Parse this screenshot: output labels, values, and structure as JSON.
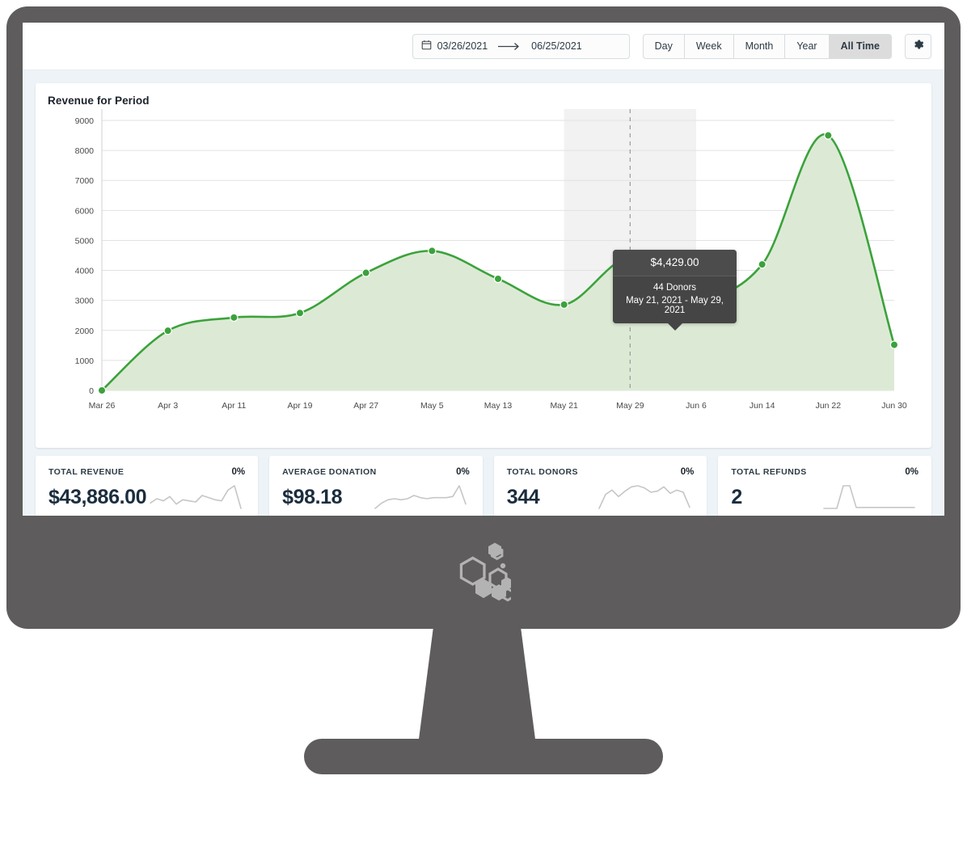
{
  "toolbar": {
    "calendar_icon": "calendar-icon",
    "date_start": "03/26/2021",
    "date_end": "06/25/2021",
    "arrow_icon": "arrow-right-icon",
    "gear_icon": "gear-icon",
    "ranges": [
      {
        "label": "Day",
        "active": false
      },
      {
        "label": "Week",
        "active": false
      },
      {
        "label": "Month",
        "active": false
      },
      {
        "label": "Year",
        "active": false
      },
      {
        "label": "All Time",
        "active": true
      }
    ]
  },
  "tooltip": {
    "amount": "$4,429.00",
    "donors": "44 Donors",
    "range": "May 21, 2021 - May 29, 2021"
  },
  "kpis": [
    {
      "label": "Total Revenue",
      "percent": "0%",
      "value": "$43,886.00",
      "spark": [
        14,
        18,
        16,
        20,
        13,
        17,
        16,
        15,
        21,
        19,
        17,
        16,
        26,
        30,
        9
      ]
    },
    {
      "label": "Average Donation",
      "percent": "0%",
      "value": "$98.18",
      "spark": [
        8,
        13,
        16,
        17,
        16,
        17,
        20,
        18,
        17,
        18,
        18,
        18,
        19,
        29,
        12
      ]
    },
    {
      "label": "Total Donors",
      "percent": "0%",
      "value": "344",
      "spark": [
        9,
        22,
        26,
        20,
        25,
        29,
        30,
        28,
        24,
        25,
        29,
        23,
        26,
        24,
        10
      ]
    },
    {
      "label": "Total Refunds",
      "percent": "0%",
      "value": "2",
      "spark": [
        6,
        6,
        6,
        30,
        30,
        7,
        7,
        7,
        7,
        7,
        7,
        7,
        7,
        7,
        7
      ]
    }
  ],
  "colors": {
    "line": "#3ba23b",
    "fill": "#dcead5",
    "marker": "#3ba23b",
    "highlight_band": "#f2f2f2",
    "grid": "#e2e2e2",
    "accent_active": "#dcdcdc"
  },
  "chart_data": {
    "type": "area",
    "title": "Revenue for Period",
    "xlabel": "",
    "ylabel": "",
    "ylim": [
      0,
      9000
    ],
    "yticks": [
      0,
      1000,
      2000,
      3000,
      4000,
      5000,
      6000,
      7000,
      8000,
      9000
    ],
    "grid": true,
    "legend": "none",
    "categories": [
      "Mar 26",
      "Apr 3",
      "Apr 11",
      "Apr 19",
      "Apr 27",
      "May 5",
      "May 13",
      "May 21",
      "May 29",
      "Jun 6",
      "Jun 14",
      "Jun 22",
      "Jun 30"
    ],
    "values": [
      0,
      1990,
      2430,
      2580,
      3920,
      4650,
      3720,
      2860,
      4429,
      3130,
      4200,
      8500,
      1520
    ],
    "highlight": {
      "from": "May 21",
      "to": "Jun 6",
      "marker_at": "May 29"
    },
    "hover_point": {
      "category": "May 29",
      "value": 4429,
      "donors": 44,
      "range": "May 21, 2021 - May 29, 2021",
      "amount": "$4,429.00"
    }
  }
}
